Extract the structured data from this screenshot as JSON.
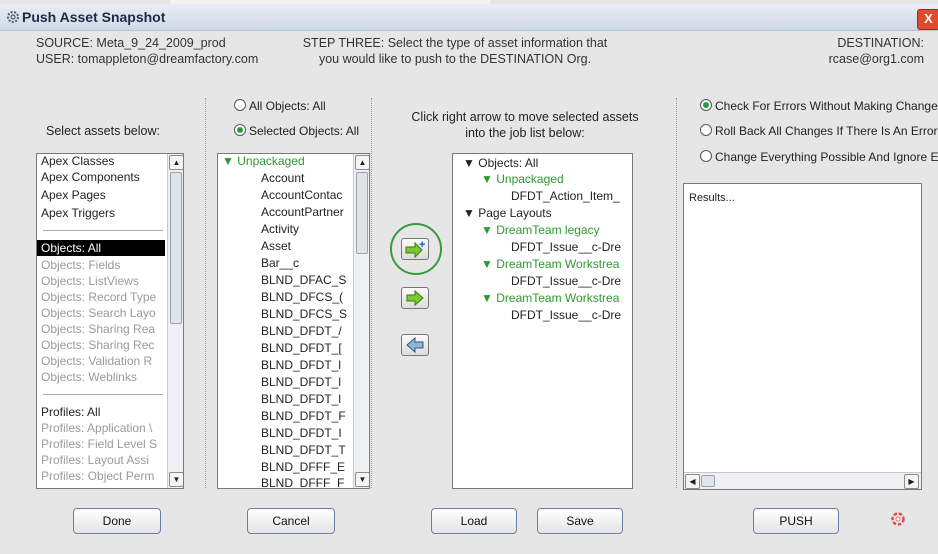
{
  "window": {
    "title": "Push Asset Snapshot",
    "close_label": "X"
  },
  "header": {
    "source_line": "SOURCE: Meta_9_24_2009_prod",
    "user_line": "USER: tomappleton@dreamfactory.com",
    "step_line1": "STEP THREE: Select the type of asset information that",
    "step_line2": "you would like to push to the DESTINATION Org.",
    "destination_label": "DESTINATION:",
    "destination_value": "rcase@org1.com"
  },
  "assets_panel": {
    "heading": "Select assets below:",
    "groups": [
      [
        "Apex Classes",
        "Apex Components",
        "Apex Pages",
        "Apex Triggers"
      ],
      [
        "Objects: All",
        "Objects: Fields",
        "Objects: ListViews",
        "Objects: Record Type",
        "Objects: Search Layo",
        "Objects: Sharing Rea",
        "Objects: Sharing Rec",
        "Objects: Validation R",
        "Objects: Weblinks"
      ],
      [
        "Profiles: All",
        "Profiles: Application \\",
        "Profiles: Field Level S",
        "Profiles: Layout Assi",
        "Profiles: Object Perm"
      ]
    ]
  },
  "objects_panel": {
    "radio_all": "All Objects: All",
    "radio_selected": "Selected Objects: All",
    "root": "Unpackaged",
    "items": [
      "Account",
      "AccountContac",
      "AccountPartner",
      "Activity",
      "Asset",
      "Bar__c",
      "BLND_DFAC_S",
      "BLND_DFCS_(",
      "BLND_DFCS_S",
      "BLND_DFDT_/",
      "BLND_DFDT_[",
      "BLND_DFDT_l",
      "BLND_DFDT_l",
      "BLND_DFDT_l",
      "BLND_DFDT_F",
      "BLND_DFDT_I",
      "BLND_DFDT_T",
      "BLND_DFFF_E",
      "BLND_DFFF_F"
    ]
  },
  "job_panel": {
    "instruction_line1": "Click right arrow to move selected assets",
    "instruction_line2": "into the job list below:",
    "tree": [
      {
        "label": "Objects: All",
        "level": 0,
        "arrow": true,
        "green": false
      },
      {
        "label": "Unpackaged",
        "level": 1,
        "arrow": true,
        "green": true
      },
      {
        "label": "DFDT_Action_Item_",
        "level": 2,
        "arrow": false,
        "green": false
      },
      {
        "label": "Page Layouts",
        "level": 0,
        "arrow": true,
        "green": false
      },
      {
        "label": "DreamTeam legacy",
        "level": 1,
        "arrow": true,
        "green": true
      },
      {
        "label": "DFDT_Issue__c-Dre",
        "level": 2,
        "arrow": false,
        "green": false
      },
      {
        "label": "DreamTeam Workstrea",
        "level": 1,
        "arrow": true,
        "green": true
      },
      {
        "label": "DFDT_Issue__c-Dre",
        "level": 2,
        "arrow": false,
        "green": false
      },
      {
        "label": "DreamTeam Workstrea",
        "level": 1,
        "arrow": true,
        "green": true
      },
      {
        "label": "DFDT_Issue__c-Dre",
        "level": 2,
        "arrow": false,
        "green": false
      }
    ]
  },
  "options_panel": {
    "opt1": "Check For Errors Without Making Change",
    "opt2": "Roll Back All Changes If There Is An Error",
    "opt3": "Change Everything Possible And Ignore E",
    "results_text": "Results..."
  },
  "buttons": {
    "done": "Done",
    "cancel": "Cancel",
    "load": "Load",
    "save": "Save",
    "push": "PUSH"
  },
  "colors": {
    "accent_green": "#2e9a2e",
    "highlight_ring": "#3a9a3a",
    "close_red": "#e04a2f"
  },
  "icons": [
    "gear-icon",
    "add-to-job-arrow-icon",
    "move-right-arrow-icon",
    "move-left-arrow-icon",
    "lifebuoy-icon"
  ]
}
